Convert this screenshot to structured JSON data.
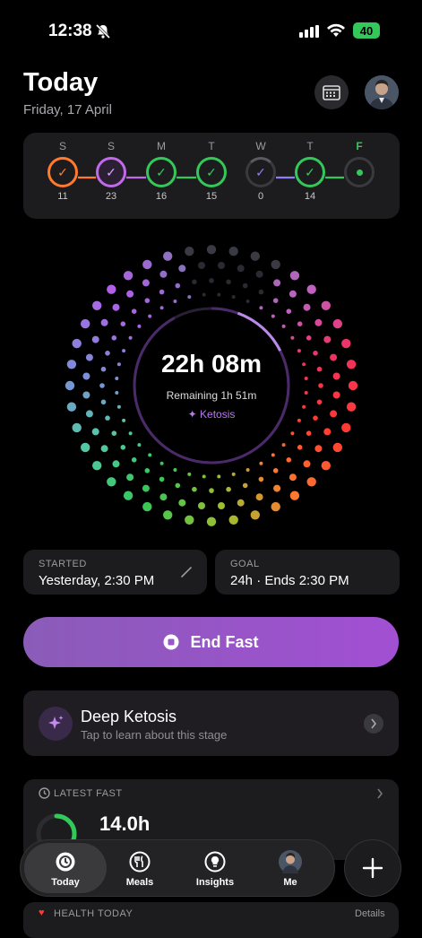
{
  "status": {
    "time": "12:38",
    "battery": "40"
  },
  "header": {
    "title": "Today",
    "date": "Friday, 17 April"
  },
  "week": [
    {
      "letter": "S",
      "count": "11",
      "state": "done",
      "ring": "#ff7a2f",
      "check": "#ff7a2f"
    },
    {
      "letter": "S",
      "count": "23",
      "state": "done",
      "ring": "#c06ae8",
      "check": "#d9a6ff"
    },
    {
      "letter": "M",
      "count": "16",
      "state": "done",
      "ring": "#34c759",
      "check": "#34c759"
    },
    {
      "letter": "T",
      "count": "15",
      "state": "done",
      "ring": "#34c759",
      "check": "#34c759"
    },
    {
      "letter": "W",
      "count": "0",
      "state": "partial",
      "ring": "#3a3a3e",
      "check": "#8c7ff0"
    },
    {
      "letter": "T",
      "count": "14",
      "state": "done",
      "ring": "#34c759",
      "check": "#34c759"
    },
    {
      "letter": "F",
      "count": "",
      "state": "today",
      "ring": "#3a3a3e",
      "check": "#34c759"
    }
  ],
  "timer": {
    "elapsed": "22h 08m",
    "remaining": "Remaining 1h 51m",
    "stage": "Ketosis",
    "progress": 0.92
  },
  "started": {
    "caption": "STARTED",
    "value": "Yesterday, 2:30 PM"
  },
  "goal": {
    "caption": "GOAL",
    "value": "24h · Ends 2:30 PM"
  },
  "end_button": {
    "label": "End Fast"
  },
  "stage_card": {
    "title": "Deep Ketosis",
    "subtitle": "Tap to learn about this stage"
  },
  "latest": {
    "caption": "LATEST FAST",
    "value": "14.0h",
    "progress": 0.58
  },
  "health": {
    "caption": "HEALTH TODAY",
    "link": "Details"
  },
  "tabs": [
    {
      "label": "Today",
      "icon": "timer-icon",
      "active": true
    },
    {
      "label": "Meals",
      "icon": "fork-knife-icon",
      "active": false
    },
    {
      "label": "Insights",
      "icon": "lightbulb-icon",
      "active": false
    },
    {
      "label": "Me",
      "icon": "avatar",
      "active": false
    }
  ],
  "colors": {
    "accent": "#a24fd3",
    "green": "#34c759",
    "orange": "#ff7a2f",
    "card": "#1c1c1e"
  }
}
